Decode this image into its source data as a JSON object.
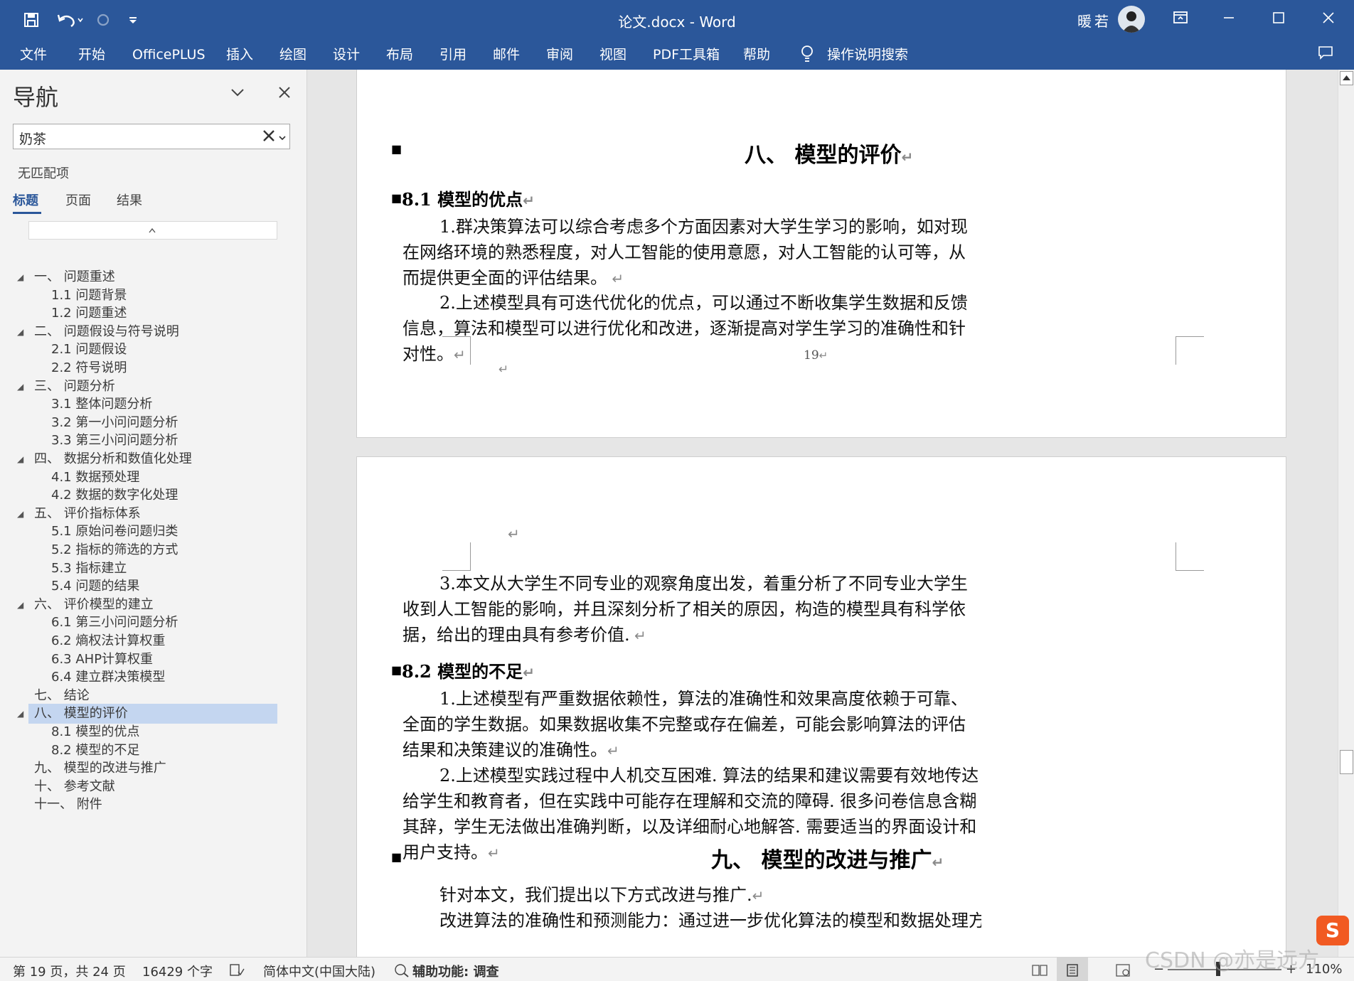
{
  "titlebar": {
    "doc_title": "论文.docx  -  Word",
    "user_name": "暖若"
  },
  "ribbon_tabs": [
    "文件",
    "开始",
    "OfficePLUS",
    "插入",
    "绘图",
    "设计",
    "布局",
    "引用",
    "邮件",
    "审阅",
    "视图",
    "PDF工具箱",
    "帮助"
  ],
  "tell_me": "操作说明搜索",
  "nav": {
    "title": "导航",
    "search_value": "奶茶",
    "no_match": "无匹配项",
    "tabs": [
      "标题",
      "页面",
      "结果"
    ],
    "headings": [
      {
        "label": "一、 问题重述",
        "level": 1,
        "expanded": true
      },
      {
        "label": "1.1 问题背景",
        "level": 2
      },
      {
        "label": "1.2 问题重述",
        "level": 2
      },
      {
        "label": "二、 问题假设与符号说明",
        "level": 1,
        "expanded": true
      },
      {
        "label": "2.1 问题假设",
        "level": 2
      },
      {
        "label": "2.2 符号说明",
        "level": 2
      },
      {
        "label": "三、 问题分析",
        "level": 1,
        "expanded": true
      },
      {
        "label": "3.1 整体问题分析",
        "level": 2
      },
      {
        "label": "3.2 第一小问问题分析",
        "level": 2
      },
      {
        "label": "3.3 第三小问问题分析",
        "level": 2
      },
      {
        "label": "四、 数据分析和数值化处理",
        "level": 1,
        "expanded": true
      },
      {
        "label": "4.1 数据预处理",
        "level": 2
      },
      {
        "label": "4.2 数据的数字化处理",
        "level": 2
      },
      {
        "label": "五、 评价指标体系",
        "level": 1,
        "expanded": true
      },
      {
        "label": "5.1 原始问卷问题归类",
        "level": 2
      },
      {
        "label": "5.2 指标的筛选的方式",
        "level": 2
      },
      {
        "label": "5.3 指标建立",
        "level": 2
      },
      {
        "label": "5.4 问题的结果",
        "level": 2
      },
      {
        "label": "六、 评价模型的建立",
        "level": 1,
        "expanded": true
      },
      {
        "label": "6.1 第三小问问题分析",
        "level": 2
      },
      {
        "label": "6.2 熵权法计算权重",
        "level": 2
      },
      {
        "label": "6.3 AHP计算权重",
        "level": 2
      },
      {
        "label": "6.4 建立群决策模型",
        "level": 2
      },
      {
        "label": "七、 结论",
        "level": 1
      },
      {
        "label": "八、 模型的评价",
        "level": 1,
        "expanded": true,
        "selected": true
      },
      {
        "label": "8.1 模型的优点",
        "level": 2
      },
      {
        "label": "8.2 模型的不足",
        "level": 2
      },
      {
        "label": "九、 模型的改进与推广",
        "level": 1
      },
      {
        "label": "十、 参考文献",
        "level": 1
      },
      {
        "label": "十一、 附件",
        "level": 1
      }
    ]
  },
  "document": {
    "page1": {
      "heading": "八、 模型的评价",
      "subheading": "8.1 模型的优点",
      "para1": "1.群决策算法可以综合考虑多个方面因素对大学生学习的影响，如对现在网络环境的熟悉程度，对人工智能的使用意愿，对人工智能的认可等，从而提供更全面的评估结果。",
      "para2": "2.上述模型具有可迭代优化的优点，可以通过不断收集学生数据和反馈信息，算法和模型可以进行优化和改进，逐渐提高对学生学习的准确性和针对性。",
      "page_number": "19"
    },
    "page2": {
      "para3": "3.本文从大学生不同专业的观察角度出发，着重分析了不同专业大学生收到人工智能的影响，并且深刻分析了相关的原因，构造的模型具有科学依据，给出的理由具有参考价值.",
      "subheading2": "8.2 模型的不足",
      "para4": "1.上述模型有严重数据依赖性，算法的准确性和效果高度依赖于可靠、全面的学生数据。如果数据收集不完整或存在偏差，可能会影响算法的评估结果和决策建议的准确性。",
      "para5": "2.上述模型实践过程中人机交互困难. 算法的结果和建议需要有效地传达给学生和教育者，但在实践中可能存在理解和交流的障碍. 很多问卷信息含糊其辞，学生无法做出准确判断，以及详细耐心地解答. 需要适当的界面设计和用户支持。",
      "heading2": "九、 模型的改进与推广",
      "para6": "针对本文，我们提出以下方式改进与推广.",
      "para7": "改进算法的准确性和预测能力：通过进一步优化算法的模型和数据处理方法，提"
    }
  },
  "status": {
    "page": "第 19 页，共 24 页",
    "words": "16429 个字",
    "language": "简体中文(中国大陆)",
    "accessibility": "辅助功能: 调查",
    "zoom": "110%"
  },
  "watermark": "CSDN @亦是远方",
  "ime_badge": "S",
  "colors": {
    "ribbon": "#2b579a",
    "nav_selected": "#c4d6f0"
  }
}
